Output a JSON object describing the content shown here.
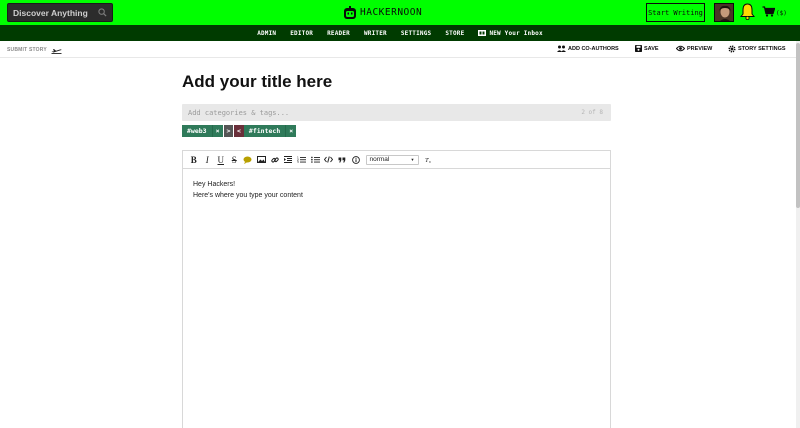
{
  "header": {
    "search_placeholder": "Discover Anything",
    "logo_text": "HACKERNOON",
    "start_writing": "Start Writing",
    "cart_count": "($)",
    "brand_color": "#00ff00"
  },
  "nav": {
    "items": [
      "ADMIN",
      "EDITOR",
      "READER",
      "WRITER",
      "SETTINGS",
      "STORE"
    ],
    "inbox": "NEW Your Inbox"
  },
  "story_toolbar": {
    "submit_story": "SUBMIT STORY",
    "add_coauthors": "ADD CO-AUTHORS",
    "save": "SAVE",
    "preview": "PREVIEW",
    "story_settings": "STORY SETTINGS"
  },
  "editor": {
    "title_placeholder": "Add your title here",
    "tags_placeholder": "Add categories & tags...",
    "tags_count": "2 of 8",
    "tags": [
      {
        "label": "#web3",
        "remove": "×",
        "next": ">"
      },
      {
        "label": "#fintech",
        "remove": "×",
        "prev": "<"
      }
    ],
    "font_size": "normal",
    "body_lines": [
      "Hey Hackers!",
      "Here's where you type your content"
    ]
  }
}
